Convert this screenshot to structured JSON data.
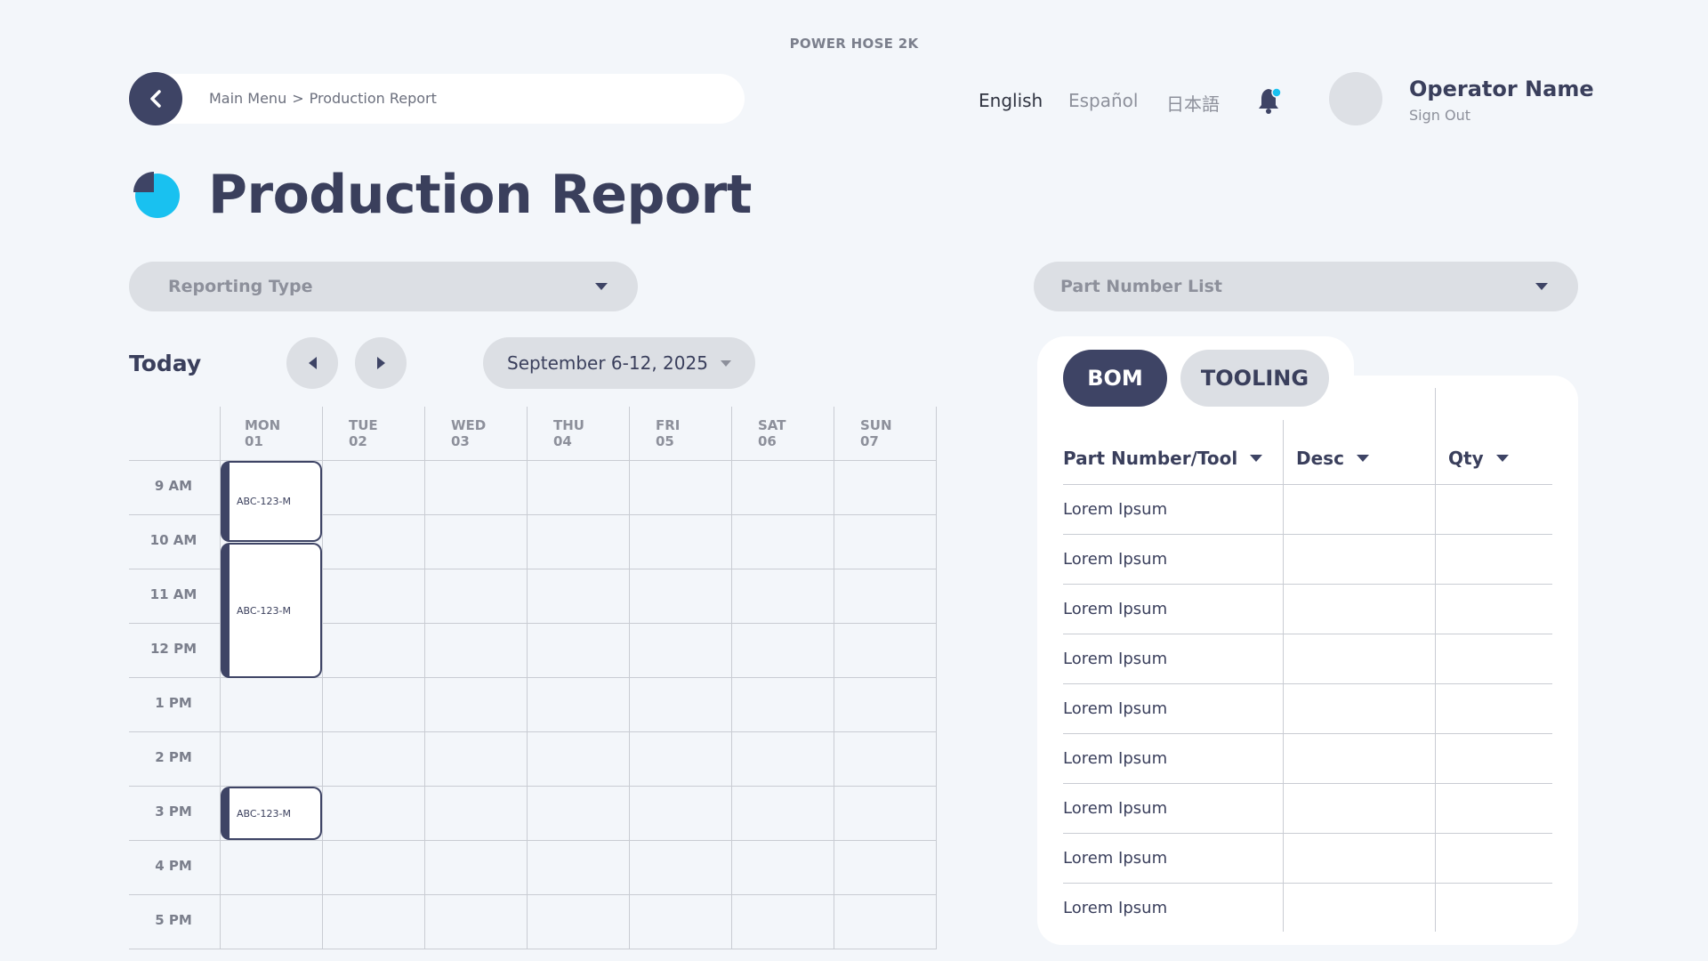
{
  "header": {
    "app_name": "POWER HOSE 2K",
    "breadcrumb": [
      "Main Menu",
      "Production Report"
    ],
    "breadcrumb_sep": ">",
    "languages": [
      "English",
      "Español",
      "日本語"
    ],
    "active_language": "English",
    "user": {
      "name": "Operator Name",
      "sign_out": "Sign Out"
    },
    "notification_dot_color": "#19c1f0"
  },
  "page": {
    "title": "Production Report",
    "title_icon": "pie-chart-icon"
  },
  "filters": {
    "reporting_type": "Reporting Type",
    "part_number_list": "Part Number List"
  },
  "calendar": {
    "today_label": "Today",
    "date_range": "September 6-12, 2025",
    "days": [
      {
        "name": "MON",
        "num": "01"
      },
      {
        "name": "TUE",
        "num": "02"
      },
      {
        "name": "WED",
        "num": "03"
      },
      {
        "name": "THU",
        "num": "04"
      },
      {
        "name": "FRI",
        "num": "05"
      },
      {
        "name": "SAT",
        "num": "06"
      },
      {
        "name": "SUN",
        "num": "07"
      }
    ],
    "times": [
      "9 AM",
      "10 AM",
      "11 AM",
      "12 PM",
      "1 PM",
      "2 PM",
      "3 PM",
      "4 PM",
      "5 PM"
    ],
    "events": [
      {
        "label": "ABC-123-M",
        "day": "MON",
        "start": "9 AM",
        "end": "10 AM"
      },
      {
        "label": "ABC-123-M",
        "day": "MON",
        "start": "10 AM",
        "end": "1 PM"
      },
      {
        "label": "ABC-123-M",
        "day": "MON",
        "start": "3 PM",
        "end": "4 PM"
      }
    ]
  },
  "bom_panel": {
    "tabs": [
      "BOM",
      "TOOLING"
    ],
    "active_tab": "BOM",
    "columns": [
      "Part Number/Tool",
      "Desc",
      "Qty"
    ],
    "rows": [
      [
        "Lorem Ipsum",
        "",
        ""
      ],
      [
        "Lorem Ipsum",
        "",
        ""
      ],
      [
        "Lorem Ipsum",
        "",
        ""
      ],
      [
        "Lorem Ipsum",
        "",
        ""
      ],
      [
        "Lorem Ipsum",
        "",
        ""
      ],
      [
        "Lorem Ipsum",
        "",
        ""
      ],
      [
        "Lorem Ipsum",
        "",
        ""
      ],
      [
        "Lorem Ipsum",
        "",
        ""
      ],
      [
        "Lorem Ipsum",
        "",
        ""
      ]
    ]
  },
  "colors": {
    "primary": "#3e4465",
    "accent": "#19c1f0",
    "background": "#f3f6fa",
    "control_bg": "#dcdfe4"
  }
}
